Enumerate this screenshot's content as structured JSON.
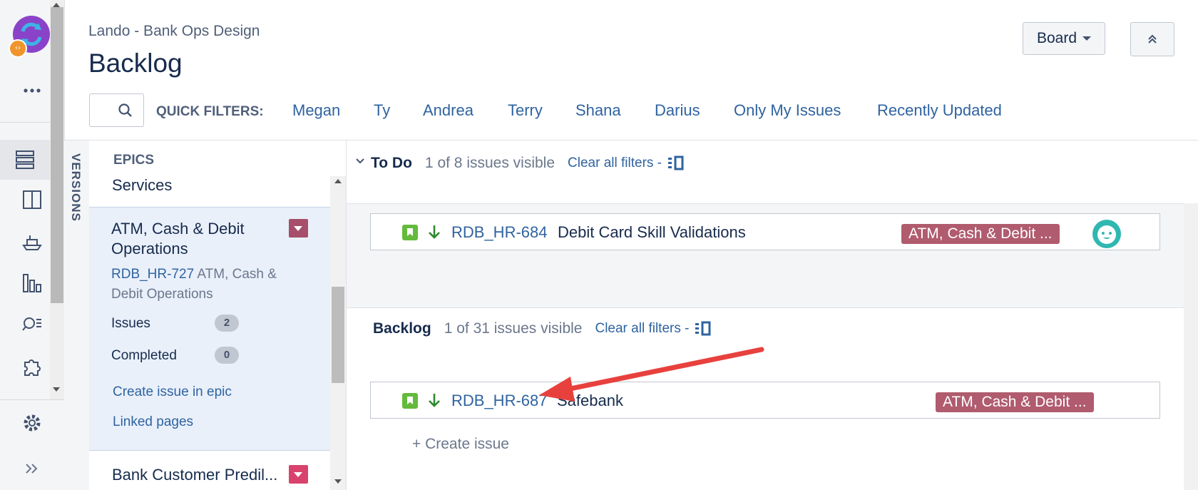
{
  "header": {
    "project_name": "Lando - Bank Ops Design",
    "page_title": "Backlog",
    "board_button": "Board"
  },
  "quick_filters": {
    "label": "QUICK FILTERS:",
    "items": [
      "Megan",
      "Ty",
      "Andrea",
      "Terry",
      "Shana",
      "Darius",
      "Only My Issues",
      "Recently Updated"
    ]
  },
  "sidebar": {
    "versions_label": "VERSIONS",
    "epics_heading": "EPICS",
    "epics": {
      "services": "Services",
      "selected": {
        "name": "ATM, Cash & Debit Operations",
        "key": "RDB_HR-727",
        "summary": "ATM, Cash & Debit Operations",
        "issues_label": "Issues",
        "issues_count": "2",
        "completed_label": "Completed",
        "completed_count": "0",
        "create_link": "Create issue in epic",
        "linked_link": "Linked pages"
      },
      "bank_customer": "Bank Customer Predil..."
    }
  },
  "todo": {
    "title": "To Do",
    "count": "1 of 8 issues visible",
    "clear": "Clear all filters -",
    "issues": [
      {
        "key": "RDB_HR-684",
        "summary": "Debit Card Skill Validations",
        "epic": "ATM, Cash & Debit ..."
      }
    ]
  },
  "backlog": {
    "title": "Backlog",
    "count": "1 of 31 issues visible",
    "clear": "Clear all filters -",
    "issues": [
      {
        "key": "RDB_HR-687",
        "summary": "Safebank",
        "epic": "ATM, Cash & Debit ..."
      }
    ],
    "create_issue": "+   Create issue"
  },
  "colors": {
    "link": "#2f63a0",
    "epic_label": "#b05b6e",
    "story_icon": "#63ba3c",
    "annotation_arrow": "#e8413d"
  }
}
